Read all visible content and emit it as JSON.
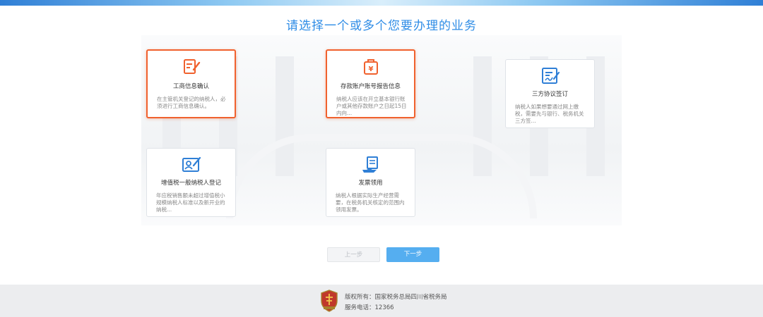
{
  "page": {
    "title": "请选择一个或多个您要办理的业务"
  },
  "colors": {
    "accent": "#2e8ce6",
    "selected_border": "#f0612e",
    "primary_button": "#55aef0",
    "icon_blue": "#2f7fd6",
    "icon_orange": "#f0612e"
  },
  "cards": [
    {
      "icon": "form-edit-icon",
      "title": "工商信息确认",
      "desc": "在主管机关登记的纳税人，必须进行工商信息确认。",
      "selected": true
    },
    {
      "icon": "bank-account-bag-icon",
      "title": "存款账户账号报告信息",
      "desc": "纳税人应该在开立基本银行账户或其他存款账户之日起15日内向...",
      "selected": true
    },
    {
      "icon": "agreement-signature-icon",
      "title": "三方协议签订",
      "desc": "纳税人如果想要通过网上缴税，需要先与银行、税务机关三方签...",
      "selected": false
    },
    {
      "icon": "id-card-register-icon",
      "title": "增值税一般纳税人登记",
      "desc": "年应税销售额未超过增值税小规模纳税人标准以及新开业的纳税...",
      "selected": false
    },
    {
      "icon": "invoice-hand-icon",
      "title": "发票领用",
      "desc": "纳税人根据实际生产经营需要，在税务机关核定的范围内领用发票。",
      "selected": false
    }
  ],
  "buttons": {
    "prev_label": "上一步",
    "next_label": "下一步"
  },
  "footer": {
    "copyright": "版权所有：国家税务总局四川省税务局",
    "phone": "服务电话：12366",
    "emblem": "tax-emblem-icon"
  }
}
